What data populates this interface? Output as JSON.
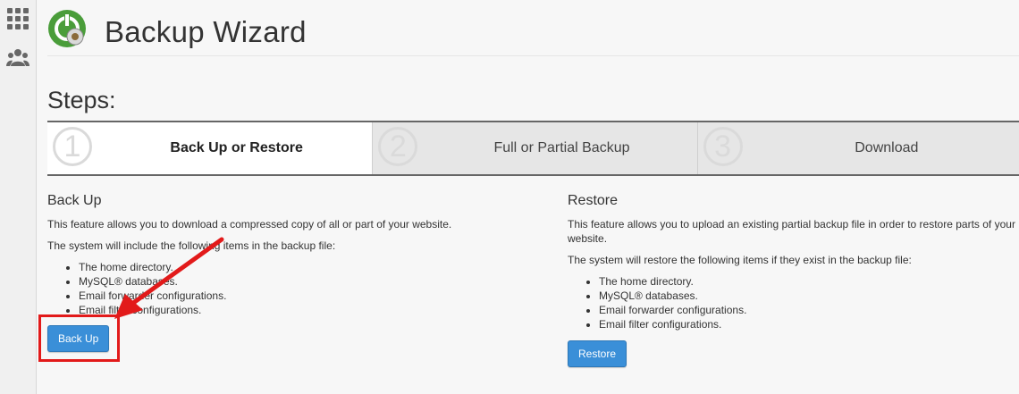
{
  "sidebar": {
    "icons": [
      "grid-icon",
      "users-icon"
    ]
  },
  "header": {
    "title": "Backup Wizard",
    "logo_icon": "backup-wizard-logo"
  },
  "steps": {
    "title": "Steps:",
    "items": [
      {
        "number": "1",
        "label": "Back Up or Restore",
        "active": true
      },
      {
        "number": "2",
        "label": "Full or Partial Backup",
        "active": false
      },
      {
        "number": "3",
        "label": "Download",
        "active": false
      }
    ]
  },
  "backup": {
    "heading": "Back Up",
    "description": "This feature allows you to download a compressed copy of all or part of your website.",
    "list_intro": "The system will include the following items in the backup file:",
    "items": [
      "The home directory.",
      "MySQL® databases.",
      "Email forwarder configurations.",
      "Email filter configurations."
    ],
    "button_label": "Back Up"
  },
  "restore": {
    "heading": "Restore",
    "description": "This feature allows you to upload an existing partial backup file in order to restore parts of your website.",
    "list_intro": "The system will restore the following items if they exist in the backup file:",
    "items": [
      "The home directory.",
      "MySQL® databases.",
      "Email forwarder configurations.",
      "Email filter configurations."
    ],
    "button_label": "Restore"
  },
  "colors": {
    "accent_button": "#3a8fd8",
    "annotation_red": "#e21a1a"
  }
}
